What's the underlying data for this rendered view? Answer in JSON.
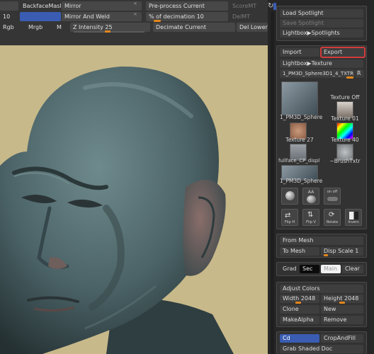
{
  "toolbar": {
    "row1": {
      "backface_mask": "BackfaceMask",
      "mirror": "Mirror",
      "preprocess_current": "Pre-process Current",
      "score_mt": "ScoreMT"
    },
    "row2": {
      "left_value": "10",
      "mirror_and_weld": "Mirror And Weld",
      "percent_decimation_label": "% of decimation",
      "percent_decimation_value": "10",
      "del_mt": "DelMT"
    },
    "row3": {
      "rgb": "Rgb",
      "mrgb": "Mrgb",
      "m": "M",
      "z_intensity_label": "Z Intensity",
      "z_intensity_value": "25",
      "decimate_current": "Decimate Current",
      "del_lower": "Del Lower"
    }
  },
  "panel": {
    "corner_icon": "refresh-icon",
    "spotlight": {
      "load_spotlight": "Load Spotlight",
      "save_spotlight": "Save Spotlight",
      "lightbox_spotlights": "Lightbox▶Spotlights"
    },
    "texture": {
      "import": "Import",
      "export": "Export",
      "lightbox_texture": "Lightbox▶Texture",
      "current_texture_name": "1_PM3D_Sphere3D1_4_TXTR",
      "current_texture_r": "R",
      "thumbnails": [
        {
          "label": "1_PM3D_Sphere"
        },
        {
          "label": "Texture Off"
        },
        {
          "label": "Texture 01"
        },
        {
          "label": "Texture 27"
        },
        {
          "label": "Texture 40"
        },
        {
          "label": "fullface_CP_displ"
        },
        {
          "label": "~BrushTxtr"
        },
        {
          "label": "1_PM3D_Sphere"
        }
      ],
      "tool_row1": [
        {
          "label": "",
          "icon": "sphere-icon"
        },
        {
          "label": "AA",
          "icon": "antialias-icon"
        },
        {
          "label": "on off",
          "icon": "toggle-icon"
        }
      ],
      "tool_row2": [
        {
          "label": "Flip H",
          "icon": "flip-h-icon"
        },
        {
          "label": "Flip V",
          "icon": "flip-v-icon"
        },
        {
          "label": "Rotate",
          "icon": "rotate-icon"
        },
        {
          "label": "Invers",
          "icon": "invert-icon"
        }
      ]
    },
    "from_mesh": {
      "from_mesh": "From Mesh",
      "to_mesh": "To Mesh",
      "disp_scale_label": "Disp Scale",
      "disp_scale_value": "1"
    },
    "grad": {
      "grad": "Grad",
      "sec": "Sec",
      "main": "Main",
      "clear": "Clear"
    },
    "adjust": {
      "adjust_colors": "Adjust Colors",
      "width_label": "Width",
      "width_value": "2048",
      "height_label": "Height",
      "height_value": "2048",
      "clone": "Clone",
      "new": "New",
      "make_alpha": "MakeAlpha",
      "remove": "Remove"
    },
    "bottom": {
      "cd": "Cd",
      "crop_and_fill": "CropAndFill",
      "grab_shaded_doc": "Grab Shaded Doc"
    }
  },
  "colors": {
    "accent_blue": "#3a5db3",
    "slider_orange": "#e3861c",
    "canvas_background": "#c8b98a",
    "highlight_red": "#d23b3b"
  }
}
